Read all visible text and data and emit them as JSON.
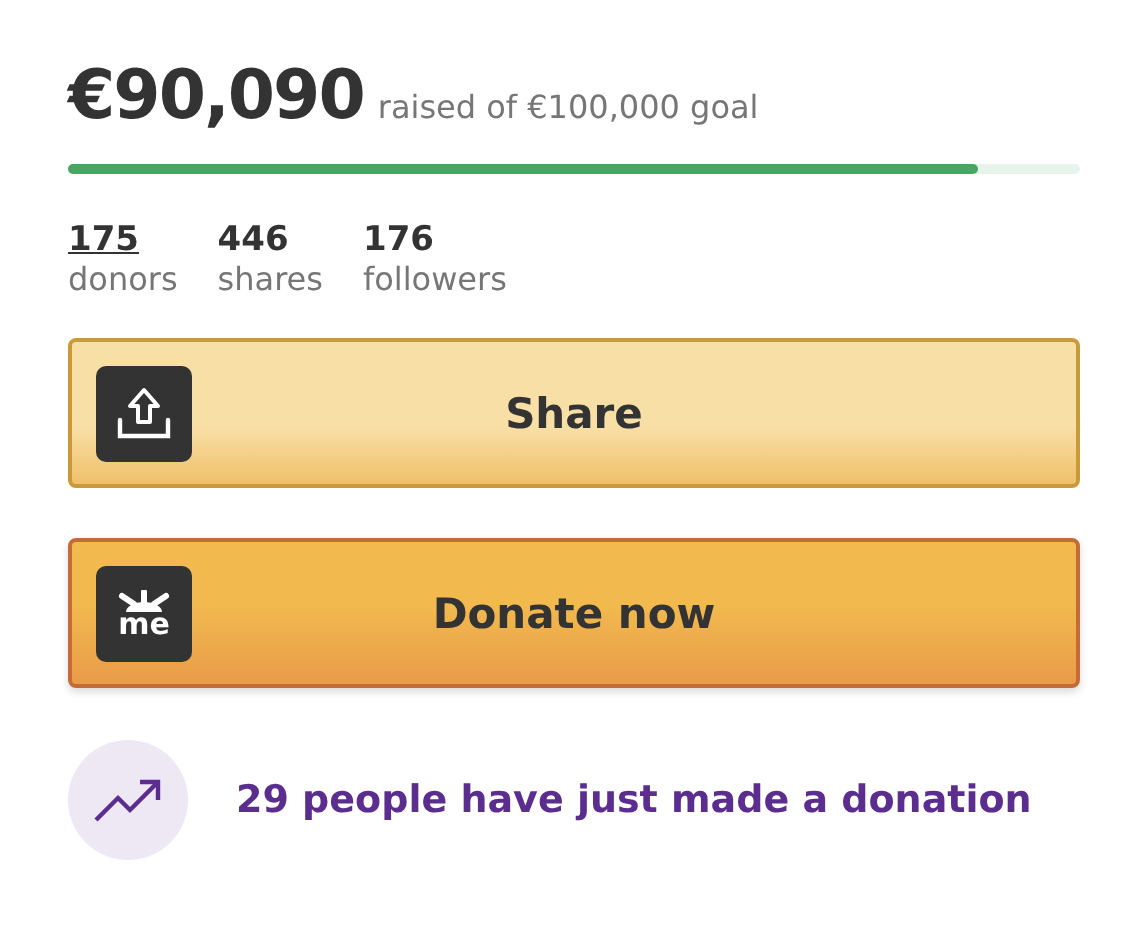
{
  "amount": "€90,090",
  "goal_text": "raised of €100,000 goal",
  "progress": {
    "level": 0.9
  },
  "stats": [
    {
      "value": "175",
      "label": "donors",
      "link": true
    },
    {
      "value": "446",
      "label": "shares",
      "link": false
    },
    {
      "value": "176",
      "label": "followers",
      "link": false
    }
  ],
  "buttons": [
    {
      "kind": "share",
      "label": "Share"
    },
    {
      "kind": "donate",
      "label": "Donate now",
      "icon_text": "me"
    }
  ],
  "activity": "29 people have just made a donation"
}
